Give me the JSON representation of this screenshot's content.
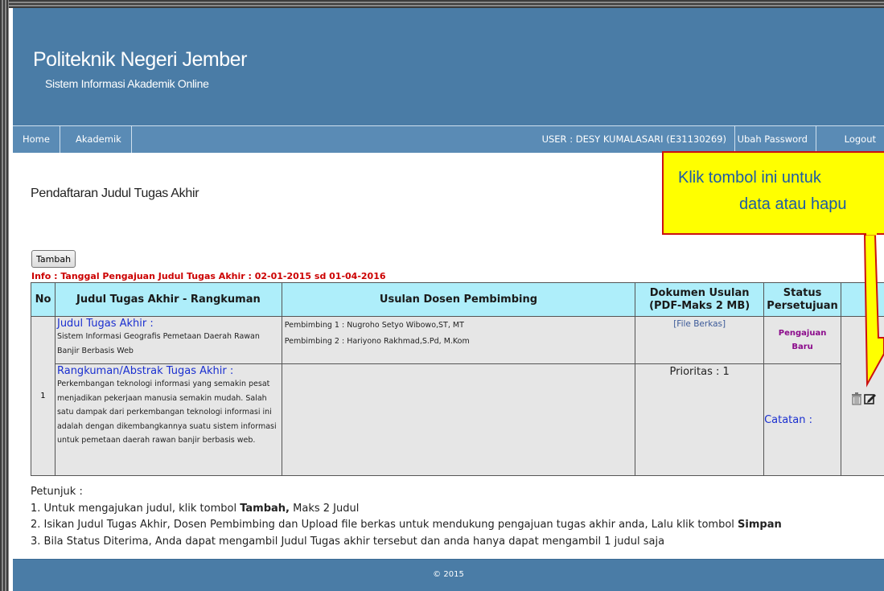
{
  "header": {
    "title": "Politeknik Negeri Jember",
    "subtitle": "Sistem Informasi Akademik Online"
  },
  "nav": {
    "home": "Home",
    "akademik": "Akademik",
    "user": "USER : DESY KUMALASARI (E31130269)",
    "ubah_password": "Ubah Password",
    "logout": "Logout"
  },
  "page_title": "Pendaftaran Judul Tugas Akhir",
  "tambah_label": "Tambah",
  "info": "Info : Tanggal Pengajuan Judul Tugas Akhir : 02-01-2015 sd 01-04-2016",
  "table": {
    "headers": {
      "no": "No",
      "judul": "Judul Tugas Akhir - Rangkuman",
      "dosen": "Usulan Dosen Pembimbing",
      "dokumen_1": "Dokumen Usulan",
      "dokumen_2": "(PDF-Maks 2 MB)",
      "status_1": "Status",
      "status_2": "Persetujuan"
    },
    "row": {
      "no": "1",
      "judul_label": "Judul Tugas Akhir :",
      "judul_text": "Sistem Informasi Geografis Pemetaan Daerah Rawan Banjir Berbasis Web",
      "pembimbing_1": "Pembimbing 1 : Nugroho Setyo Wibowo,ST, MT",
      "pembimbing_2": "Pembimbing 2 : Hariyono Rakhmad,S.Pd, M.Kom",
      "file_link": "[File Berkas]",
      "status_1": "Pengajuan",
      "status_2": "Baru",
      "rangkuman_label": "Rangkuman/Abstrak Tugas Akhir :",
      "rangkuman_text": "Perkembangan teknologi informasi yang semakin pesat menjadikan pekerjaan manusia semakin mudah. Salah satu dampak dari perkembangan teknologi informasi ini adalah dengan dikembangkannya suatu sistem informasi untuk pemetaan daerah rawan banjir berbasis web.",
      "prioritas": "Prioritas : 1",
      "catatan": "Catatan :"
    }
  },
  "petunjuk": {
    "title": "Petunjuk :",
    "line1_pre": "1. Untuk mengajukan judul, klik tombol ",
    "line1_bold": "Tambah,",
    "line1_post": " Maks 2 Judul",
    "line2_pre": "2. Isikan Judul Tugas Akhir, Dosen Pembimbing dan Upload file berkas untuk mendukung pengajuan tugas akhir anda, Lalu klik tombol ",
    "line2_bold": "Simpan",
    "line3": "3. Bila Status Diterima, Anda dapat mengambil Judul Tugas akhir tersebut dan anda hanya dapat mengambil 1 judul saja"
  },
  "footer": "© 2015",
  "callout": {
    "line1": "Klik tombol ini untuk",
    "line2": "data atau hapu"
  },
  "icons": [
    "trash-icon",
    "edit-icon"
  ],
  "colors": {
    "header_bg": "#4a7ca6",
    "table_header_bg": "#aeeefa",
    "info_red": "#cc0000",
    "callout_yellow": "#ffff00",
    "status_purple": "#8b0a8b"
  }
}
